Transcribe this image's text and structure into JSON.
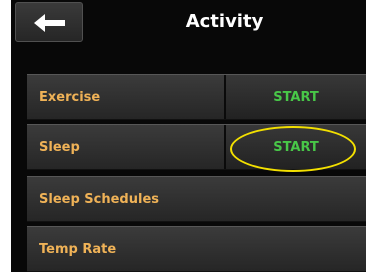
{
  "header": {
    "title": "Activity",
    "back_icon": "arrow-left-icon"
  },
  "rows": [
    {
      "label": "Exercise",
      "action": "START"
    },
    {
      "label": "Sleep",
      "action": "START"
    },
    {
      "label": "Sleep Schedules"
    },
    {
      "label": "Temp Rate"
    }
  ],
  "colors": {
    "label": "#efb257",
    "action": "#48c748",
    "highlight": "#f3e000"
  }
}
